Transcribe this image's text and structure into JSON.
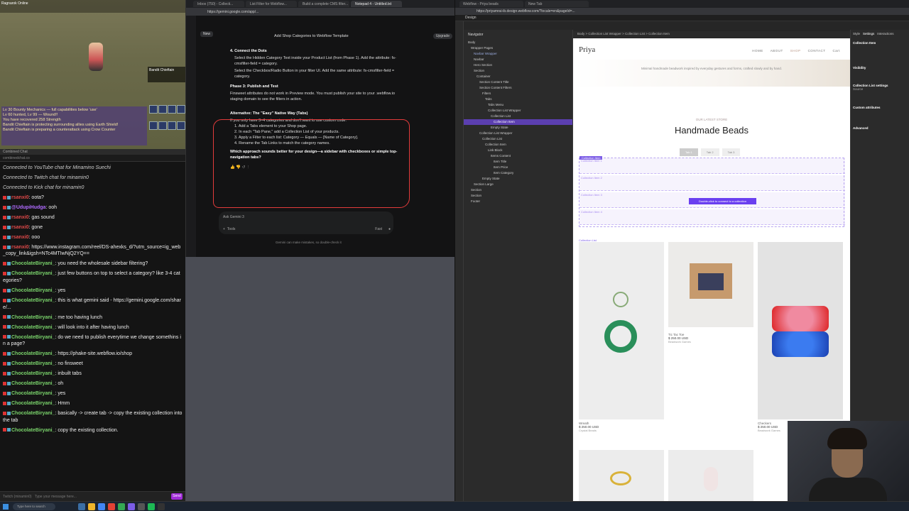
{
  "game": {
    "top_text": "Ragnarok Online",
    "boss_name": "Bandit Chieftain",
    "log_lines": [
      "Lv 30 Bounty Mechanics — full capabilities below 'use'",
      "Lv 60 hunted, Lv 99 — Wound!!",
      "You have recovered 258 Strength",
      "Bandit Chieftain is protecting surrounding allies using Earth Shield!",
      "Bandit Chieftain is preparing a counterattack using Crow Counter"
    ]
  },
  "chat": {
    "tab": "Combined Chat",
    "url": "combinedchat.co",
    "messages": [
      {
        "type": "sys",
        "text": "Connected to YouTube chat for Minamino Suechi"
      },
      {
        "type": "sys",
        "text": "Connected to Twitch chat for minamin0"
      },
      {
        "type": "sys",
        "text": "Connected to Kick chat for minamin0"
      },
      {
        "type": "msg",
        "user": "rsanxi0",
        "ucls": "u-red",
        "text": "oota?"
      },
      {
        "type": "msg",
        "user": "@UdupiHudga",
        "ucls": "u-purple",
        "text": "ooh"
      },
      {
        "type": "msg",
        "user": "rsanxi0",
        "ucls": "u-red",
        "text": "gas sound"
      },
      {
        "type": "msg",
        "user": "rsanxi0",
        "ucls": "u-red",
        "text": "gone"
      },
      {
        "type": "msg",
        "user": "rsanxi0",
        "ucls": "u-red",
        "text": "ooo"
      },
      {
        "type": "msg",
        "user": "rsanxi0",
        "ucls": "u-red",
        "text": "https://www.instagram.com/reel/DS-ahexks_d/?utm_source=ig_web_copy_link&igsh=NTc4MTIwNjQ2YQ=="
      },
      {
        "type": "msg",
        "user": "ChocolateBiryani_",
        "ucls": "u-choc",
        "text": "you need the wholesale sidebar filtering?"
      },
      {
        "type": "msg",
        "user": "ChocolateBiryani_",
        "ucls": "u-choc",
        "text": "just few buttons on top to select a category? like 3-4 categories?"
      },
      {
        "type": "msg",
        "user": "ChocolateBiryani_",
        "ucls": "u-choc",
        "text": "yes"
      },
      {
        "type": "msg",
        "user": "ChocolateBiryani_",
        "ucls": "u-choc",
        "text": "this is what gemini said - https://gemini.google.com/share/..."
      },
      {
        "type": "msg",
        "user": "ChocolateBiryani_",
        "ucls": "u-choc",
        "text": "me too having lunch"
      },
      {
        "type": "msg",
        "user": "ChocolateBiryani_",
        "ucls": "u-choc",
        "text": "will look into it after having lunch"
      },
      {
        "type": "msg",
        "user": "ChocolateBiryani_",
        "ucls": "u-choc",
        "text": "do we need to publish everytime we change somethins in a page?"
      },
      {
        "type": "msg",
        "user": "ChocolateBiryani_",
        "ucls": "u-choc",
        "text": "https://phake-site.webflow.io/shop"
      },
      {
        "type": "msg",
        "user": "ChocolateBiryani_",
        "ucls": "u-choc",
        "text": "no finsweet"
      },
      {
        "type": "msg",
        "user": "ChocolateBiryani_",
        "ucls": "u-choc",
        "text": "inbuilt tabs"
      },
      {
        "type": "msg",
        "user": "ChocolateBiryani_",
        "ucls": "u-choc",
        "text": "oh"
      },
      {
        "type": "msg",
        "user": "ChocolateBiryani_",
        "ucls": "u-choc",
        "text": "yes"
      },
      {
        "type": "msg",
        "user": "ChocolateBiryani_",
        "ucls": "u-choc",
        "text": "Hmm"
      },
      {
        "type": "msg",
        "user": "ChocolateBiryani_",
        "ucls": "u-choc",
        "text": "basically -> create tab -> copy the existing collection into the tab"
      },
      {
        "type": "msg",
        "user": "ChocolateBiryani_",
        "ucls": "u-choc",
        "text": "copy the existing collection."
      }
    ],
    "input_placeholder": "Type your message here...",
    "platform": "Twitch (minamin0)",
    "send_label": "Send"
  },
  "gemini": {
    "tabs": [
      "Inbox (750) - Collecti...",
      "List Filter for Webflow...",
      "Build a complete CMS filter...",
      "Notepad 4 - Untitled.txt"
    ],
    "url": "https://gemini.google.com/app/...",
    "new_chat": "New",
    "title": "Add Shop Categories to Webflow Template",
    "upgrade": "Upgrade",
    "step4_title": "4. Connect the Dots",
    "step4_items": [
      "Select the Hidden Category Text inside your Product List (from Phase 1). Add the attribute: fs-cmsfilter-field = category.",
      "Select the Checkbox/Radio Button in your filter UI. Add the same attribute: fs-cmsfilter-field = category."
    ],
    "phase3_title": "Phase 3: Publish and Test",
    "phase3_text": "Finsweet attributes do not work in Preview mode. You must publish your site to your .webflow.io staging domain to see the filters in action.",
    "alt_title": "Alternative: The \"Easy\" Native Way (Tabs)",
    "alt_intro": "If you only have 3–4 categories and don't want to use custom code:",
    "alt_items": [
      "Add a Tabs element to your Shop page.",
      "In each \"Tab Pane,\" add a Collection List of your products.",
      "Apply a Filter to each list: Category — Equals — [Name of Category].",
      "Rename the Tab Links to match the category names."
    ],
    "question": "Which approach sounds better for your design—a sidebar with checkboxes or simple top-navigation tabs?",
    "ask_placeholder": "Ask Gemini 3",
    "tools": "Tools",
    "mode": "Fast",
    "footer": "Gemini can make mistakes, so double-check it"
  },
  "webflow": {
    "tabs": [
      "Webflow - Priya beads",
      "New Tab"
    ],
    "url": "https://priyamrai-ib.design.webflow.com/?locale=en&pageId=...",
    "mode": "Design",
    "navigator_title": "Navigator",
    "nav_items": [
      {
        "t": "Body",
        "i": 0
      },
      {
        "t": "Wrapper Pages",
        "i": 1
      },
      {
        "t": "Navbar Wrapper",
        "i": 2,
        "c": "hl"
      },
      {
        "t": "Navbar",
        "i": 2
      },
      {
        "t": "Hero Section",
        "i": 2
      },
      {
        "t": "Section",
        "i": 2
      },
      {
        "t": "Container",
        "i": 3
      },
      {
        "t": "Section Content Title",
        "i": 4
      },
      {
        "t": "Section Content Filters",
        "i": 4
      },
      {
        "t": "Filters",
        "i": 5
      },
      {
        "t": "Tabs",
        "i": 6
      },
      {
        "t": "Tabs Menu",
        "i": 7
      },
      {
        "t": "Collection List Wrapper",
        "i": 7
      },
      {
        "t": "Collection List",
        "i": 8
      },
      {
        "t": "Collection Item",
        "i": 9,
        "c": "sel"
      },
      {
        "t": "Empty State",
        "i": 8
      },
      {
        "t": "Collection List Wrapper",
        "i": 4
      },
      {
        "t": "Collection List",
        "i": 5
      },
      {
        "t": "Collection Item",
        "i": 6
      },
      {
        "t": "Link Block",
        "i": 7
      },
      {
        "t": "Items Content",
        "i": 8
      },
      {
        "t": "Item Title",
        "i": 9
      },
      {
        "t": "Item Price",
        "i": 9
      },
      {
        "t": "Item Category",
        "i": 9
      },
      {
        "t": "Empty State",
        "i": 5
      },
      {
        "t": "Section Large",
        "i": 2
      },
      {
        "t": "Section",
        "i": 1
      },
      {
        "t": "Section",
        "i": 1
      },
      {
        "t": "Footer",
        "i": 1
      }
    ],
    "breadcrumb": "Body  >  Collection List Wrapper  >  Collection List  >  Collection Item",
    "site": {
      "logo": "Priya",
      "nav": [
        "HOME",
        "ABOUT",
        "SHOP",
        "CONTACT",
        "Cart"
      ],
      "hero_text": "Minimal handmade beadwork inspired by everyday gestures and forms, crafted slowly and by hand.",
      "eyebrow": "OUR LATEST STORE",
      "title": "Handmade Beads",
      "tabs": [
        "Tab 1",
        "Tab 2",
        "Tab 3"
      ],
      "collection_items": [
        "Collection Item 1",
        "Collection Item 2",
        "Collection Item 3",
        "Collection Item 4"
      ],
      "collection_badge": "Collection Item",
      "dbl_click": "Double-click to connect to a collection",
      "product_label": "Collection List",
      "products": [
        {
          "name": "Wreath",
          "price": "$ 250.00 USD",
          "maker": "Crystal Beads"
        },
        {
          "name": "Tic Tac Toe",
          "price": "$ 250.00 USD",
          "maker": "Beadwork Games"
        },
        {
          "name": "Checkers",
          "price": "$ 250.00 USD",
          "maker": "Beadwork Games"
        }
      ]
    },
    "right_panel": {
      "tabs": [
        "Style",
        "Settings",
        "Interactions"
      ],
      "collection_item": "Collection Item",
      "visibility": "Visibility",
      "cls": "Collection List settings",
      "source": "Source",
      "custom_attrs": "Custom attributes",
      "advanced": "Advanced"
    }
  },
  "taskbar": {
    "search": "Type here to search"
  }
}
